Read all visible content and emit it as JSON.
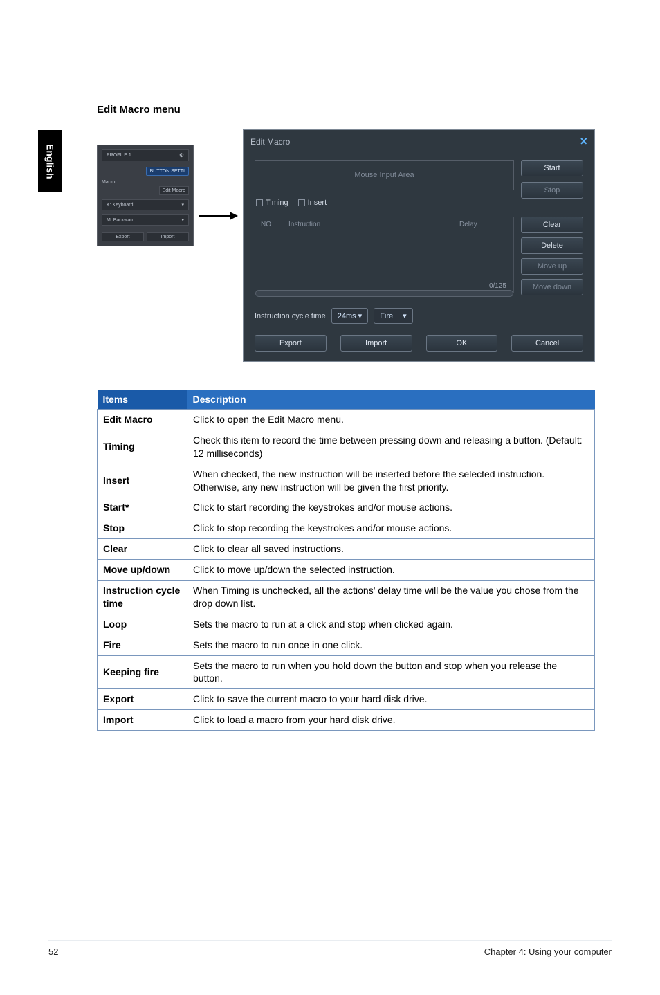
{
  "sidebar": {
    "language_tab": "English"
  },
  "heading": "Edit Macro menu",
  "mini_panel": {
    "profile": "PROFILE 1",
    "button_setting": "BUTTON SETTI",
    "macro_label": "Macro",
    "edit_macro_btn": "Edit Macro",
    "keyboard_label": "K: Keyboard",
    "backward_label": "M: Backward",
    "export_btn": "Export",
    "import_btn": "Import"
  },
  "edit_macro": {
    "title": "Edit Macro",
    "input_area": "Mouse Input Area",
    "tab_timing": "Timing",
    "tab_insert": "Insert",
    "btn_start": "Start",
    "btn_stop": "Stop",
    "btn_clear": "Clear",
    "btn_delete": "Delete",
    "btn_moveup": "Move up",
    "btn_movedown": "Move down",
    "col_no": "NO",
    "col_instruction": "Instruction",
    "col_delay": "Delay",
    "count": "0/125",
    "cycle_label": "Instruction cycle time",
    "cycle_value": "24ms ▾",
    "mode_value": "Fire",
    "btn_export": "Export",
    "btn_import": "Import",
    "btn_ok": "OK",
    "btn_cancel": "Cancel"
  },
  "table": {
    "header_items": "Items",
    "header_desc": "Description",
    "rows": [
      {
        "key": "Edit Macro",
        "desc": "Click to open the Edit Macro menu."
      },
      {
        "key": "Timing",
        "desc": "Check this item to record the time between pressing down and releasing a button. (Default: 12 milliseconds)"
      },
      {
        "key": "Insert",
        "desc": "When checked, the new instruction will be inserted before the selected instruction. Otherwise, any new instruction will be given the first priority."
      },
      {
        "key": "Start*",
        "desc": "Click to start recording the keystrokes and/or mouse actions."
      },
      {
        "key": "Stop",
        "desc": "Click to stop recording the keystrokes and/or mouse actions."
      },
      {
        "key": "Clear",
        "desc": "Click to clear all saved instructions."
      },
      {
        "key": "Move up/down",
        "desc": "Click to move up/down the selected instruction."
      },
      {
        "key": "Instruction cycle time",
        "desc": "When Timing is unchecked, all the actions' delay time will be the value you chose from the drop down list."
      },
      {
        "key": "Loop",
        "desc": "Sets the macro to run at a click and stop when clicked again."
      },
      {
        "key": "Fire",
        "desc": "Sets the macro to run once in one click."
      },
      {
        "key": "Keeping fire",
        "desc": "Sets the macro to run when you hold down the button and stop when you release the button."
      },
      {
        "key": "Export",
        "desc": "Click to save the current macro to your hard disk drive."
      },
      {
        "key": "Import",
        "desc": "Click to load a macro from your hard disk drive."
      }
    ]
  },
  "footer": {
    "page": "52",
    "chapter": "Chapter 4: Using your computer"
  }
}
